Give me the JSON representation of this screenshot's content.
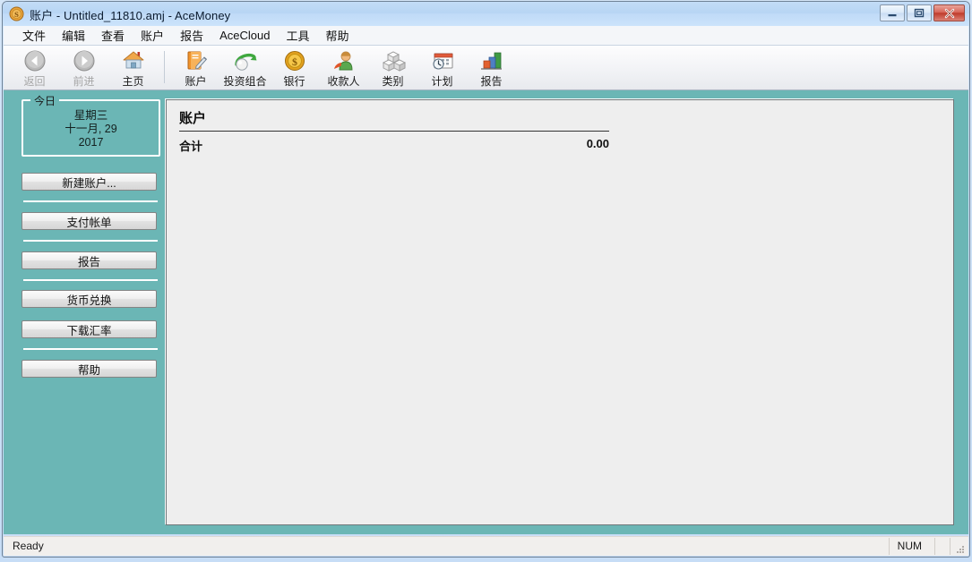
{
  "window": {
    "title": "账户 - Untitled_11810.amj - AceMoney",
    "app_icon": "coin-dollar-icon",
    "caption": {
      "minimize": "minimize-icon",
      "maximize": "maximize-icon",
      "close": "close-icon"
    },
    "colors": {
      "titlebar": "#b7d5f4",
      "sidebar_teal": "#6bb6b5",
      "panel_bg": "#eeeeee",
      "statusbar": "#f1efed"
    }
  },
  "menubar": {
    "items": [
      {
        "label": "文件"
      },
      {
        "label": "编辑"
      },
      {
        "label": "查看"
      },
      {
        "label": "账户"
      },
      {
        "label": "报告"
      },
      {
        "label": "AceCloud"
      },
      {
        "label": "工具"
      },
      {
        "label": "帮助"
      }
    ]
  },
  "toolbar": {
    "items": [
      {
        "label": "返回",
        "icon": "back-arrow-icon",
        "disabled": true
      },
      {
        "label": "前进",
        "icon": "forward-arrow-icon",
        "disabled": true
      },
      {
        "label": "主页",
        "icon": "home-icon",
        "disabled": false
      },
      {
        "label": "账户",
        "icon": "account-book-icon",
        "disabled": false
      },
      {
        "label": "投资组合",
        "icon": "portfolio-icon",
        "disabled": false
      },
      {
        "label": "银行",
        "icon": "bank-coin-icon",
        "disabled": false
      },
      {
        "label": "收款人",
        "icon": "payee-person-icon",
        "disabled": false
      },
      {
        "label": "类别",
        "icon": "categories-cubes-icon",
        "disabled": false
      },
      {
        "label": "计划",
        "icon": "schedule-calendar-icon",
        "disabled": false
      },
      {
        "label": "报告",
        "icon": "reports-chart-icon",
        "disabled": false
      }
    ]
  },
  "sidebar": {
    "today_group_label": "今日",
    "today": {
      "weekday": "星期三",
      "month_day": "十一月, 29",
      "year": "2017"
    },
    "buttons": [
      {
        "label": "新建账户..."
      },
      {
        "label": "支付帐单"
      },
      {
        "label": "报告"
      },
      {
        "label": "货币兑换"
      },
      {
        "label": "下载汇率"
      },
      {
        "label": "帮助"
      }
    ]
  },
  "main": {
    "title": "账户",
    "total_label": "合计",
    "total_value": "0.00"
  },
  "statusbar": {
    "message": "Ready",
    "num_lock": "NUM"
  }
}
